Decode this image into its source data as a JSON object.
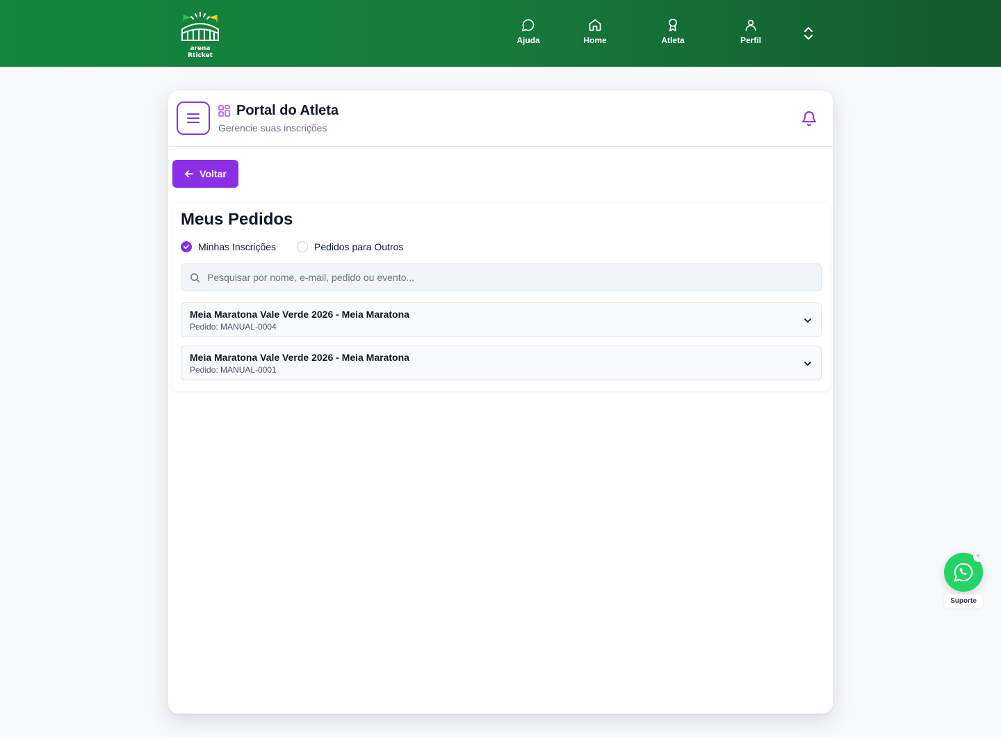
{
  "header": {
    "logo_text": "arena Rticket",
    "nav": [
      {
        "label": "Ajuda",
        "icon": "chat-bubble-icon"
      },
      {
        "label": "Home",
        "icon": "home-icon"
      },
      {
        "label": "Atleta",
        "icon": "medal-icon"
      },
      {
        "label": "Perfil",
        "icon": "user-icon"
      }
    ],
    "toggle_icon": "chevron-up-down-icon",
    "colors": {
      "start": "#12873f",
      "end": "#14582c"
    }
  },
  "portal": {
    "title": "Portal do Atleta",
    "subtitle": "Gerencie suas inscrições",
    "accent": "#8b2fe6"
  },
  "back_button": {
    "label": "Voltar"
  },
  "orders_panel": {
    "title": "Meus Pedidos",
    "filters": [
      {
        "label": "Minhas Inscrições",
        "selected": true
      },
      {
        "label": "Pedidos para Outros",
        "selected": false
      }
    ],
    "search_placeholder": "Pesquisar por nome, e-mail, pedido ou evento...",
    "orders": [
      {
        "title": "Meia Maratona Vale Verde 2026 - Meia Maratona",
        "id": "Pedido: MANUAL-0004"
      },
      {
        "title": "Meia Maratona Vale Verde 2026 - Meia Maratona",
        "id": "Pedido: MANUAL-0001"
      }
    ]
  },
  "support": {
    "label": "Suporte",
    "close": "+",
    "color": "#25d366"
  }
}
